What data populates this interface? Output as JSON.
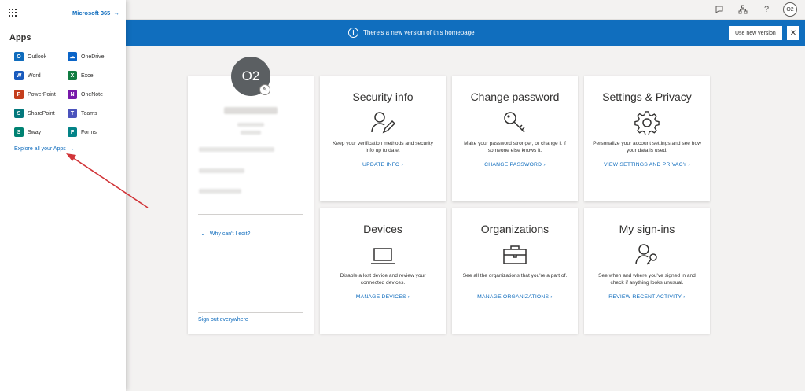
{
  "panel": {
    "brand_label": "Microsoft 365",
    "brand_arrow": "→",
    "apps_title": "Apps",
    "apps": [
      {
        "name": "Outlook",
        "icon": "outlook-icon",
        "color": "#0f6cbd",
        "glyph": "O"
      },
      {
        "name": "OneDrive",
        "icon": "onedrive-icon",
        "color": "#0a64c8",
        "glyph": "☁"
      },
      {
        "name": "Word",
        "icon": "word-icon",
        "color": "#185abd",
        "glyph": "W"
      },
      {
        "name": "Excel",
        "icon": "excel-icon",
        "color": "#107c41",
        "glyph": "X"
      },
      {
        "name": "PowerPoint",
        "icon": "powerpoint-icon",
        "color": "#c43e1c",
        "glyph": "P"
      },
      {
        "name": "OneNote",
        "icon": "onenote-icon",
        "color": "#7719aa",
        "glyph": "N"
      },
      {
        "name": "SharePoint",
        "icon": "sharepoint-icon",
        "color": "#03787c",
        "glyph": "S"
      },
      {
        "name": "Teams",
        "icon": "teams-icon",
        "color": "#4b53bc",
        "glyph": "T"
      },
      {
        "name": "Sway",
        "icon": "sway-icon",
        "color": "#008272",
        "glyph": "S"
      },
      {
        "name": "Forms",
        "icon": "forms-icon",
        "color": "#038387",
        "glyph": "F"
      }
    ],
    "explore_label": "Explore all your Apps",
    "explore_arrow": "→"
  },
  "topbar": {
    "avatar_initials": "O2",
    "help_glyph": "?"
  },
  "banner": {
    "message": "There's a new version of this homepage",
    "info_glyph": "i",
    "button_label": "Use new version",
    "close_glyph": "✕"
  },
  "profile": {
    "initials": "O2",
    "edit_glyph": "✎",
    "why_edit": "Why can't I edit?",
    "why_chevron": "⌄",
    "sign_out": "Sign out everywhere"
  },
  "tiles": [
    {
      "title": "Security info",
      "desc": "Keep your verification methods and security info up to date.",
      "link": "UPDATE INFO ›"
    },
    {
      "title": "Change password",
      "desc": "Make your password stronger, or change it if someone else knows it.",
      "link": "CHANGE PASSWORD ›"
    },
    {
      "title": "Settings & Privacy",
      "desc": "Personalize your account settings and see how your data is used.",
      "link": "VIEW SETTINGS AND PRIVACY ›"
    },
    {
      "title": "Devices",
      "desc": "Disable a lost device and review your connected devices.",
      "link": "MANAGE DEVICES ›"
    },
    {
      "title": "Organizations",
      "desc": "See all the organizations that you're a part of.",
      "link": "MANAGE ORGANIZATIONS ›"
    },
    {
      "title": "My sign-ins",
      "desc": "See when and where you've signed in and check if anything looks unusual.",
      "link": "REVIEW RECENT ACTIVITY ›"
    }
  ],
  "colors": {
    "banner": "#106ebe",
    "link": "#0f6cbd",
    "annotation_arrow": "#d13438"
  }
}
